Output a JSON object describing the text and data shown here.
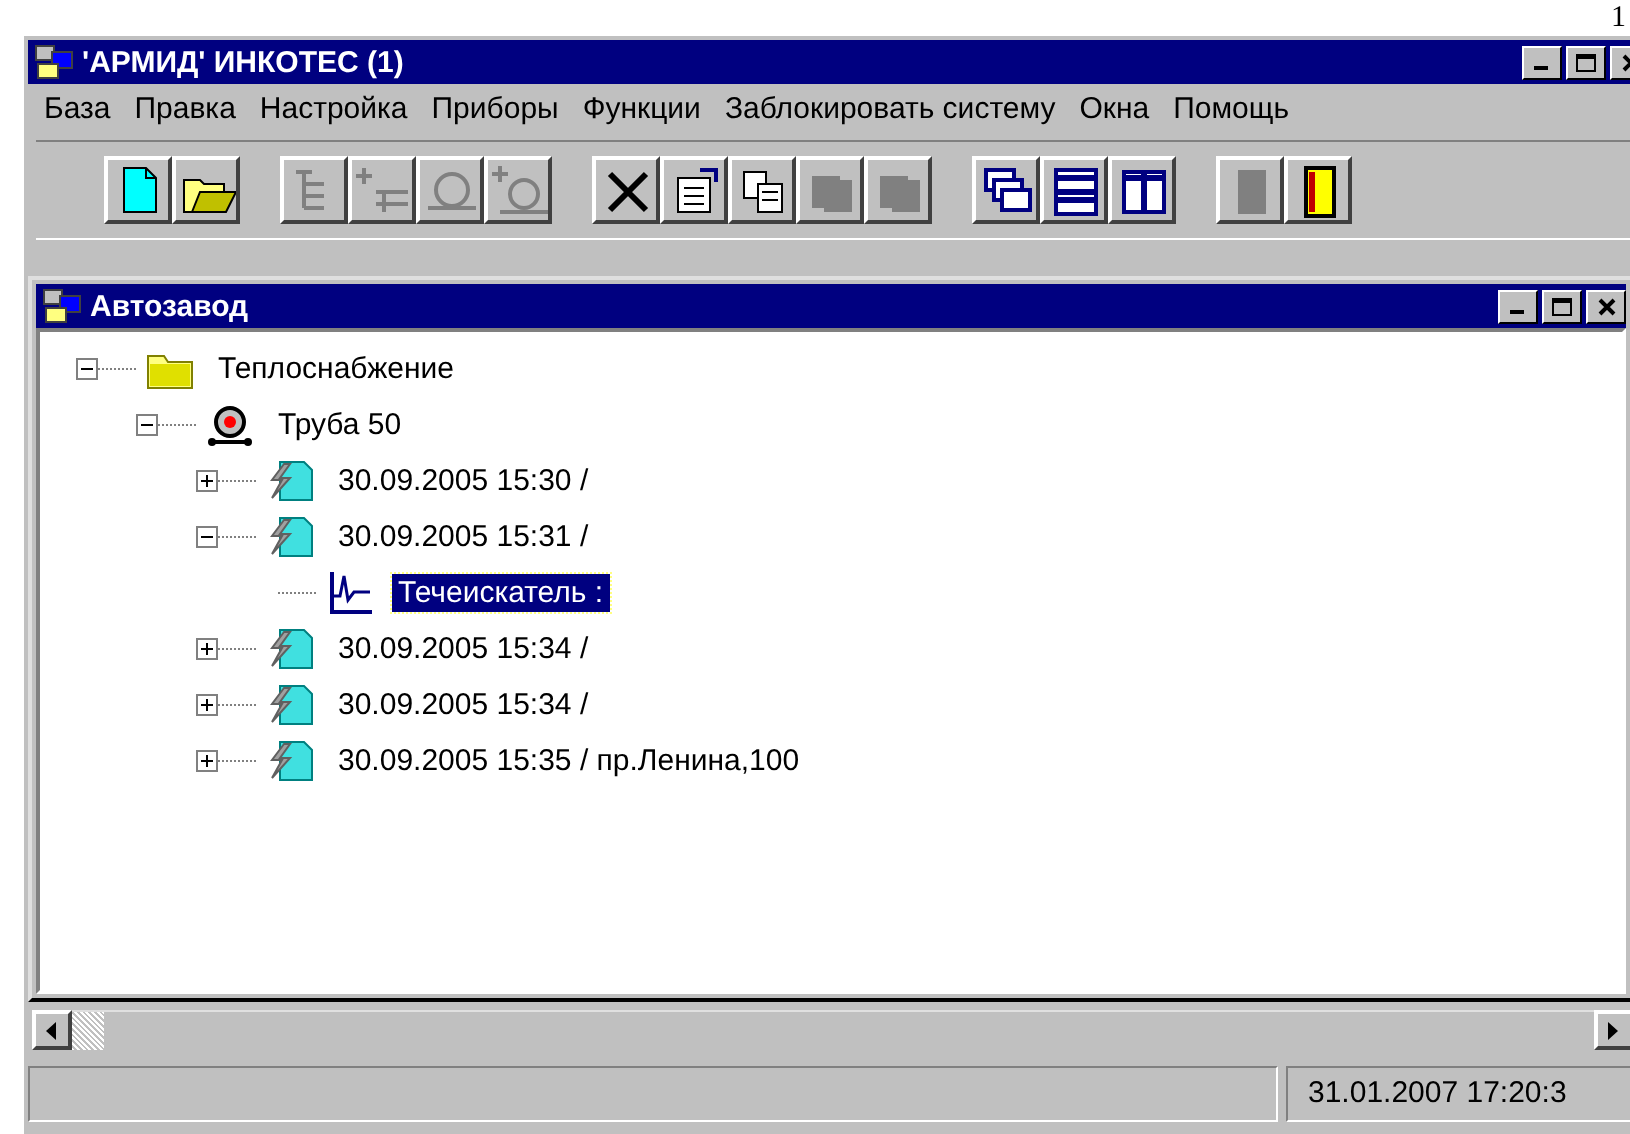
{
  "page_mark": "1",
  "window": {
    "title": "'АРМИД' ИНКОТЕС (1)"
  },
  "menu": [
    "База",
    "Правка",
    "Настройка",
    "Приборы",
    "Функции",
    "Заблокировать систему",
    "Окна",
    "Помощь"
  ],
  "toolbar": [
    [
      {
        "kind": "new",
        "disabled": false
      },
      {
        "kind": "open",
        "disabled": false
      }
    ],
    [
      {
        "kind": "tree",
        "disabled": true
      },
      {
        "kind": "add-node",
        "disabled": true
      },
      {
        "kind": "device",
        "disabled": true
      },
      {
        "kind": "add-device",
        "disabled": true
      }
    ],
    [
      {
        "kind": "delete",
        "disabled": false
      },
      {
        "kind": "properties",
        "disabled": false
      },
      {
        "kind": "copy",
        "disabled": false
      },
      {
        "kind": "stack",
        "disabled": true
      },
      {
        "kind": "stack",
        "disabled": true
      }
    ],
    [
      {
        "kind": "cascade",
        "disabled": false
      },
      {
        "kind": "tile-horizontal",
        "disabled": false
      },
      {
        "kind": "tile-vertical",
        "disabled": false
      }
    ],
    [
      {
        "kind": "clipboard",
        "disabled": true
      },
      {
        "kind": "exit",
        "disabled": false
      }
    ]
  ],
  "child_window": {
    "title": "Автозавод",
    "tree": [
      {
        "kind": "folder",
        "label": "Теплоснабжение",
        "expanded": true,
        "selected": false,
        "children": [
          {
            "kind": "device",
            "label": "Труба 50",
            "expanded": true,
            "selected": false,
            "children": [
              {
                "kind": "record",
                "label": "30.09.2005 15:30 /",
                "expanded": false,
                "selected": false
              },
              {
                "kind": "record",
                "label": "30.09.2005 15:31 /",
                "expanded": true,
                "selected": false,
                "children": [
                  {
                    "kind": "graph",
                    "label": "Течеискатель :",
                    "selected": true
                  }
                ]
              },
              {
                "kind": "record",
                "label": "30.09.2005 15:34 /",
                "expanded": false,
                "selected": false
              },
              {
                "kind": "record",
                "label": "30.09.2005 15:34 /",
                "expanded": false,
                "selected": false
              },
              {
                "kind": "record",
                "label": "30.09.2005 15:35 / пр.Ленина,100",
                "expanded": false,
                "selected": false
              }
            ]
          }
        ]
      }
    ]
  },
  "status_bar": {
    "panel_2": "31.01.2007 17:20:3"
  }
}
